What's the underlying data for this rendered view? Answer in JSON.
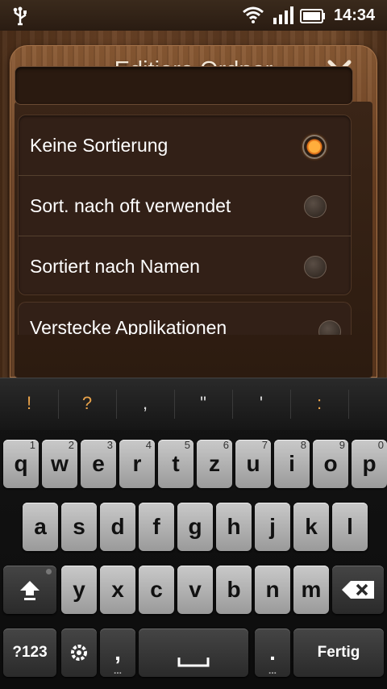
{
  "status_bar": {
    "time": "14:34",
    "icons": [
      "usb-icon",
      "wifi-icon",
      "signal-icon",
      "battery-icon"
    ]
  },
  "dialog": {
    "title": "Editiere Ordner",
    "name_value": "",
    "sort_options": [
      {
        "label": "Keine Sortierung",
        "selected": true
      },
      {
        "label": "Sort. nach oft verwendet",
        "selected": false
      },
      {
        "label": "Sortiert nach Namen",
        "selected": false
      }
    ],
    "hide_apps_label": "Verstecke Applikationen"
  },
  "keyboard": {
    "suggestions": [
      "!",
      "?",
      ",",
      "\"",
      "'",
      ":"
    ],
    "row1": [
      {
        "label": "q",
        "num": "1"
      },
      {
        "label": "w",
        "num": "2"
      },
      {
        "label": "e",
        "num": "3"
      },
      {
        "label": "r",
        "num": "4"
      },
      {
        "label": "t",
        "num": "5"
      },
      {
        "label": "z",
        "num": "6"
      },
      {
        "label": "u",
        "num": "7"
      },
      {
        "label": "i",
        "num": "8"
      },
      {
        "label": "o",
        "num": "9"
      },
      {
        "label": "p",
        "num": "0"
      }
    ],
    "row2": [
      "a",
      "s",
      "d",
      "f",
      "g",
      "h",
      "j",
      "k",
      "l"
    ],
    "row3": [
      "y",
      "x",
      "c",
      "v",
      "b",
      "n",
      "m"
    ],
    "symbols_label": "?123",
    "comma_label": ",",
    "period_label": ".",
    "done_label": "Fertig",
    "accent_color": "#e8a24a"
  }
}
